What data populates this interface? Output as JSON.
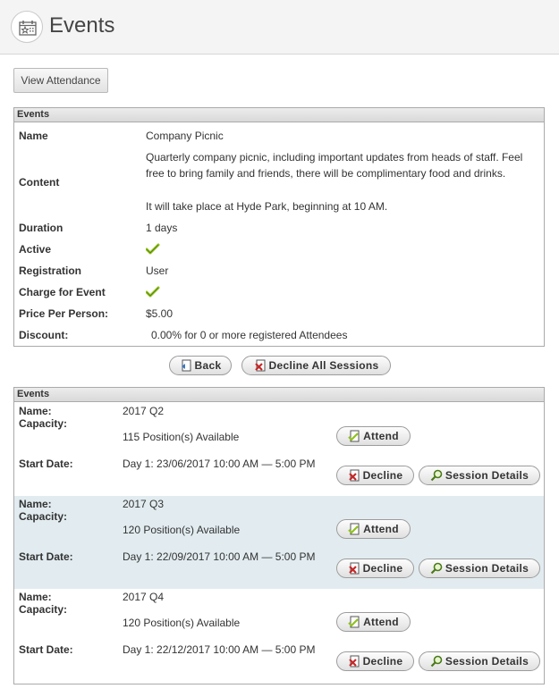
{
  "header": {
    "title": "Events"
  },
  "toolbar": {
    "view_attendance_label": "View Attendance"
  },
  "details": {
    "panel_title": "Events",
    "name_label": "Name",
    "name_value": "Company Picnic",
    "content_label": "Content",
    "content_line1": "Quarterly company picnic, including important updates from heads of staff. Feel free to bring family and friends, there will be complimentary food and drinks.",
    "content_line2": "It will take place at Hyde Park, beginning at 10 AM.",
    "duration_label": "Duration",
    "duration_value": "1 days",
    "active_label": "Active",
    "registration_label": "Registration",
    "registration_value": "User",
    "charge_label": "Charge for Event",
    "price_label": "Price Per Person:",
    "price_value": "$5.00",
    "discount_label": "Discount:",
    "discount_value": "0.00% for 0 or more registered Attendees"
  },
  "actions": {
    "back_label": "Back",
    "decline_all_label": "Decline All Sessions"
  },
  "sessions": {
    "panel_title": "Events",
    "name_label": "Name:",
    "capacity_label": "Capacity:",
    "start_label": "Start Date:",
    "attend_label": "Attend",
    "decline_label": "Decline",
    "details_label": "Session Details",
    "items": [
      {
        "name": "2017 Q2",
        "capacity": "115 Position(s) Available",
        "start": "Day 1:  23/06/2017 10:00 AM — 5:00 PM"
      },
      {
        "name": "2017 Q3",
        "capacity": "120 Position(s) Available",
        "start": "Day 1:  22/09/2017 10:00 AM — 5:00 PM"
      },
      {
        "name": "2017 Q4",
        "capacity": "120 Position(s) Available",
        "start": "Day 1:  22/12/2017 10:00 AM — 5:00 PM"
      }
    ]
  },
  "colors": {
    "check": "#8fc21c",
    "decline_x": "#c62828",
    "alt_row": "#e2ecf0"
  }
}
